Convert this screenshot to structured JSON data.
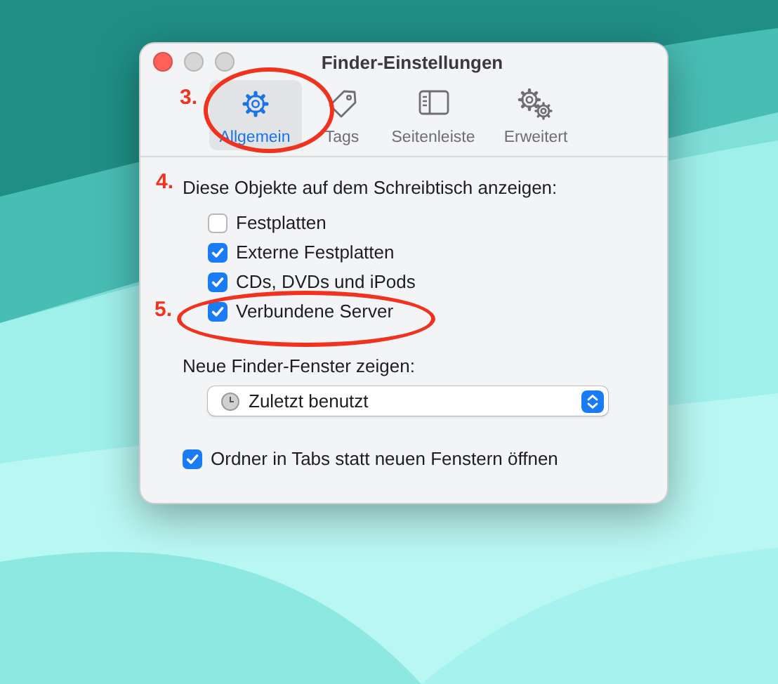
{
  "window": {
    "title": "Finder-Einstellungen"
  },
  "tabs": [
    {
      "label": "Allgemein",
      "selected": true,
      "kind": "gear"
    },
    {
      "label": "Tags",
      "selected": false,
      "kind": "tag"
    },
    {
      "label": "Seitenleiste",
      "selected": false,
      "kind": "sidebar"
    },
    {
      "label": "Erweitert",
      "selected": false,
      "kind": "gears"
    }
  ],
  "desktop_items": {
    "heading": "Diese Objekte auf dem Schreibtisch anzeigen:",
    "items": [
      {
        "label": "Festplatten",
        "checked": false
      },
      {
        "label": "Externe Festplatten",
        "checked": true
      },
      {
        "label": "CDs, DVDs und iPods",
        "checked": true
      },
      {
        "label": "Verbundene Server",
        "checked": true
      }
    ]
  },
  "new_window": {
    "label": "Neue Finder-Fenster zeigen:",
    "value": "Zuletzt benutzt"
  },
  "open_in_tabs": {
    "label": "Ordner in Tabs statt neuen Fenstern öffnen",
    "checked": true
  },
  "annotations": [
    {
      "number": "3.",
      "kind": "ellipse"
    },
    {
      "number": "4.",
      "kind": "none"
    },
    {
      "number": "5.",
      "kind": "ellipse"
    }
  ]
}
